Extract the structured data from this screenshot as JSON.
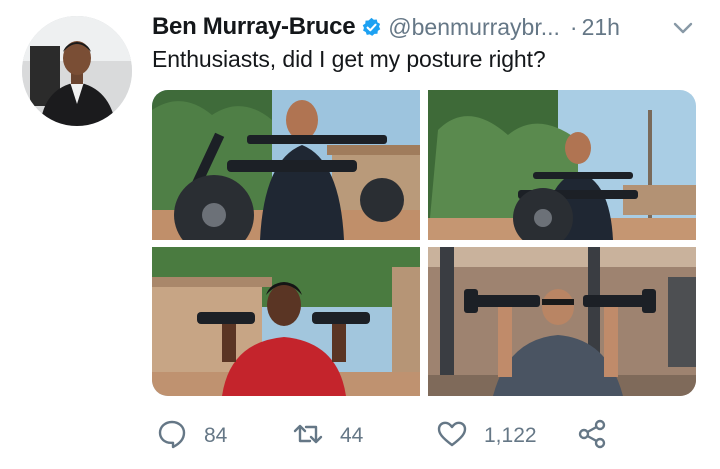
{
  "tweet": {
    "author_name": "Ben Murray-Bruce",
    "handle": "@benmurraybr...",
    "separator": "·",
    "time": "21h",
    "text": "Enthusiasts, did I get my posture right?",
    "verified": true
  },
  "actions": {
    "reply_count": "84",
    "retweet_count": "44",
    "like_count": "1,122"
  },
  "icons": {
    "verified": "verified-badge-icon",
    "menu": "chevron-down-icon",
    "reply": "reply-icon",
    "retweet": "retweet-icon",
    "like": "heart-icon",
    "share": "share-icon"
  },
  "colors": {
    "text": "#14171a",
    "secondary": "#657786",
    "verified_blue": "#1da1f2"
  },
  "photos": [
    {
      "label": "man-lifting-barbell-outdoors"
    },
    {
      "label": "man-lifting-barbell-wide"
    },
    {
      "label": "young-man-dumbbell-press"
    },
    {
      "label": "man-seated-dumbbell-press"
    }
  ]
}
